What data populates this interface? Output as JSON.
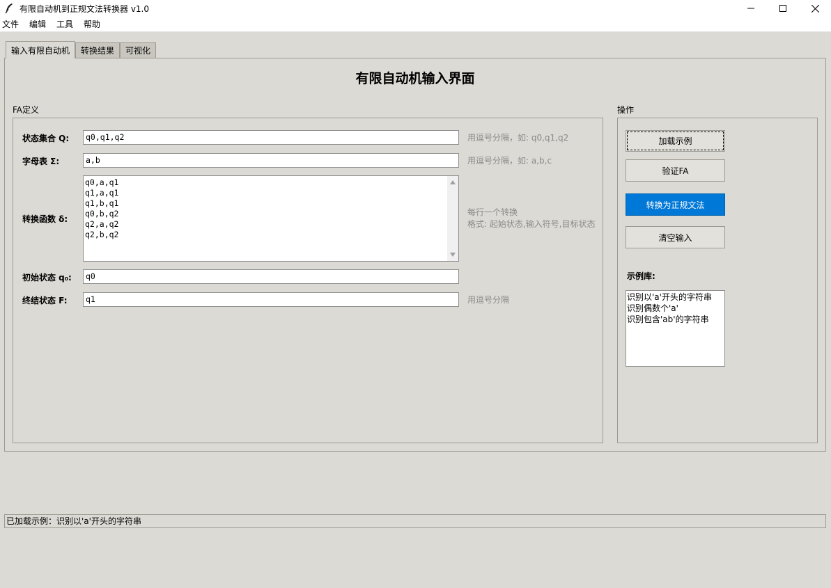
{
  "window": {
    "title": "有限自动机到正规文法转换器 v1.0"
  },
  "menu": [
    "文件",
    "编辑",
    "工具",
    "帮助"
  ],
  "tabs": [
    {
      "label": "输入有限自动机",
      "active": true
    },
    {
      "label": "转换结果",
      "active": false
    },
    {
      "label": "可视化",
      "active": false
    }
  ],
  "page": {
    "title": "有限自动机输入界面"
  },
  "fa": {
    "group_label": "FA定义",
    "states": {
      "label": "状态集合 Q:",
      "value": "q0,q1,q2",
      "hint": "用逗号分隔，如: q0,q1,q2"
    },
    "alphabet": {
      "label": "字母表 Σ:",
      "value": "a,b",
      "hint": "用逗号分隔，如: a,b,c"
    },
    "transitions": {
      "label": "转换函数 δ:",
      "lines": [
        "q0,a,q1",
        "q1,a,q1",
        "q1,b,q1",
        "q0,b,q2",
        "q2,a,q2",
        "q2,b,q2"
      ],
      "hint_line1": "每行一个转换",
      "hint_line2": "格式: 起始状态,输入符号,目标状态"
    },
    "start": {
      "label": "初始状态 q₀:",
      "value": "q0"
    },
    "final": {
      "label": "终结状态 F:",
      "value": "q1",
      "hint": "用逗号分隔"
    }
  },
  "ops": {
    "group_label": "操作",
    "load_example": "加载示例",
    "validate": "验证FA",
    "convert": "转换为正规文法",
    "clear": "清空输入",
    "examples_label": "示例库:",
    "examples": [
      "识别以'a'开头的字符串",
      "识别偶数个'a'",
      "识别包含'ab'的字符串"
    ]
  },
  "status": {
    "text": "已加载示例：识别以'a'开头的字符串"
  },
  "colors": {
    "primary_button": "#0078d7",
    "background": "#dcdad5"
  }
}
